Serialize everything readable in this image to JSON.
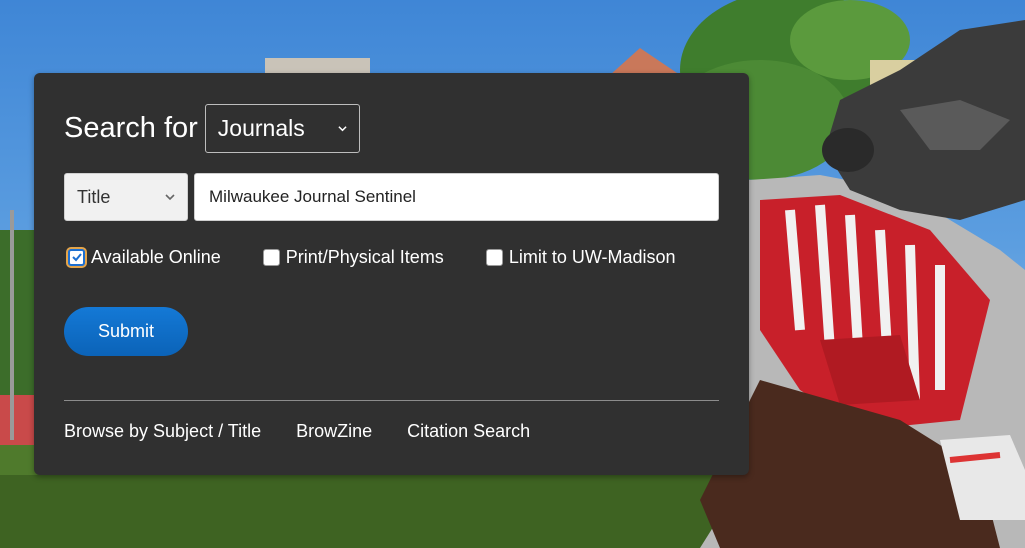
{
  "search": {
    "label": "Search for",
    "type_select": {
      "value": "Journals",
      "icon": "chevron-down-icon"
    },
    "field_select": {
      "value": "Title",
      "icon": "chevron-down-icon"
    },
    "query": {
      "value": "Milwaukee Journal Sentinel"
    },
    "filters": [
      {
        "label": "Available Online",
        "checked": true
      },
      {
        "label": "Print/Physical Items",
        "checked": false
      },
      {
        "label": "Limit to UW-Madison",
        "checked": false
      }
    ],
    "submit_label": "Submit"
  },
  "links": [
    {
      "label": "Browse by Subject / Title"
    },
    {
      "label": "BrowZine"
    },
    {
      "label": "Citation Search"
    }
  ],
  "colors": {
    "panel_bg": "#303030",
    "submit_blue": "#0b63b8",
    "focus_ring": "#e3a44a"
  }
}
